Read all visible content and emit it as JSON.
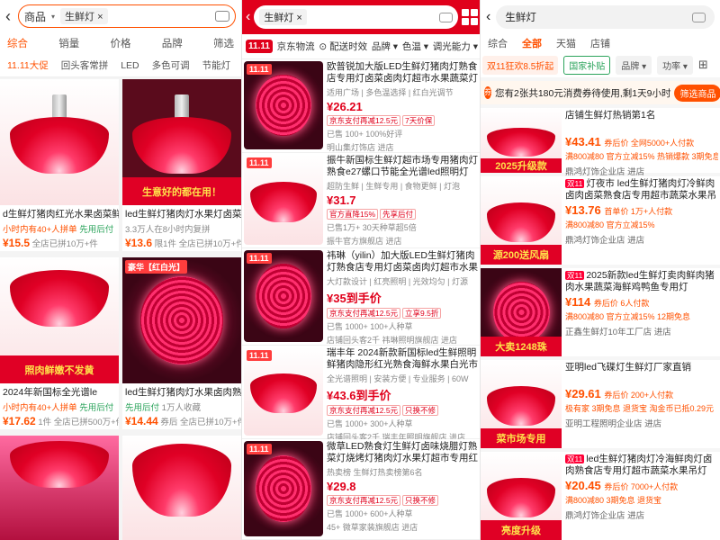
{
  "panel1": {
    "search_scope": "商品",
    "search_chip": "生鲜灯",
    "sort": [
      "综合",
      "销量",
      "价格",
      "品牌",
      "筛选"
    ],
    "tags": [
      "11.11大促",
      "回头客常拼",
      "LED",
      "多色可调",
      "节能灯",
      "圆形"
    ],
    "cards": [
      {
        "title": "d生鲜灯猪肉红光水果卤菜鲜",
        "sub": "小时内有40+人拼单",
        "sub2": "先用后付",
        "price": "¥15.5",
        "meta": "全店已拼10万+件",
        "banner": ""
      },
      {
        "title": "led生鲜灯猪肉灯水果灯卤菜熟",
        "sub": "3.3万人在8小时内复拼",
        "sub2": "",
        "price": "¥13.6",
        "meta": "限1件 全店已拼10万+件",
        "banner": "生意好的都在用！"
      },
      {
        "title": "2024年新国标全光谱le",
        "sub": "小时内有40+人拼单",
        "sub2": "先用后付",
        "price": "¥17.62",
        "meta": "1件 全店已拼500万+件",
        "banner": "照肉鲜嫩不发黄"
      },
      {
        "title": "led生鲜灯猪肉灯水果卤肉熟",
        "sub": "先用后付",
        "sub2": "1万人收藏",
        "price": "¥14.44",
        "meta": "券后 全店已拼10万+件",
        "banner": "豪华【红白光】"
      }
    ]
  },
  "panel2": {
    "search_chip": "生鲜灯",
    "filters": [
      "11.11",
      "京东物流",
      "配送时效",
      "品牌",
      "色温",
      "调光能力"
    ],
    "items": [
      {
        "title": "欧普锐加大版LED生鲜灯猪肉灯熟食店专用灯卤菜卤肉灯超市水果蔬菜灯 鲜肉专",
        "line": "适用广场 | 多色温选择 | 红白光调节",
        "price": "¥26.21",
        "tags": [
          "京东支付再减12.5元",
          "7天价保"
        ],
        "meta": "已售 100+ 100%好评",
        "shop": "明山集灯饰店 进店"
      },
      {
        "title": "振牛新国标生鲜灯超市场专用猪肉灯熟食e27螺口节能全光谱led照明灯 新国标",
        "line": "超防生鲜 | 生鲜专用 | 食物更鲜 | 灯泡",
        "price": "¥31.7",
        "tags": [
          "官方直降15%",
          "先享后付"
        ],
        "meta": "已售1万+ 30天种草超5倍",
        "shop": "振牛官方旗舰店 进店"
      },
      {
        "title": "祎琳（yilin）加大版LED生鲜灯猪肉灯熟食店专用灯卤菜卤肉灯超市水果蔬菜吊灯 鲜",
        "line": "大灯款设计 | 红亮照明 | 光效均匀 | 灯源",
        "price": "¥35到手价",
        "tags": [
          "京东支付再减12.5元",
          "立享9.5折"
        ],
        "meta": "已售 1000+ 100+人种草",
        "shop": "店铺回头客2千 祎琳照明旗舰店 进店"
      },
      {
        "title": "瑞丰年 2024新款新国标led生鲜照明鲜猪肉隐形红光熟食海鲜水果白光市场灯【鲜肉专",
        "line": "全光谱照明 | 安装方便 | 专业服务 | 60W",
        "price": "¥43.6到手价",
        "tags": [
          "京东支付再减12.5元",
          "只换不修"
        ],
        "meta": "已售 1000+ 300+人种草",
        "shop": "店铺回头客2千 瑞丰年照明旗舰店 进店"
      },
      {
        "title": "微草LED熟食灯生鲜灯卤味烧腊灯熟菜灯烧烤灯猪肉灯水果灯超市专用红黄光 45五",
        "line": "热卖榜 生鲜灯热卖榜第6名",
        "price": "¥29.8",
        "tags": [
          "京东支付再减12.5元",
          "只换不修"
        ],
        "meta": "已售 1000+ 600+人种草",
        "shop": "45+ 微草家装旗舰店 进店"
      }
    ]
  },
  "panel3": {
    "search_text": "生鲜灯",
    "tabs": [
      "全部",
      "天猫",
      "店铺"
    ],
    "scope_tab": "综合",
    "chips": [
      "双11狂欢8.5折起",
      "国家补贴",
      "品牌",
      "功率"
    ],
    "coupon": {
      "text": "您有2张共180元消费券待使用,剩1天9小时",
      "btn": "筛选商品"
    },
    "items": [
      {
        "badge": "",
        "title": "店铺生鲜灯热销第1名",
        "price": "¥43.41",
        "price_note": "券后价 全网5000+人付款",
        "meta": "满800减80 官方立减15% 热销爆款 3期免息",
        "shop": "鼎鸿灯饰企业店 进店",
        "banner": "2025升级款"
      },
      {
        "badge": "双11",
        "title": "灯夜市 led生鲜灯猪肉灯冷鲜肉卤肉卤菜熟食店专用超市蔬菜水果吊",
        "price": "¥13.76",
        "price_note": "首单价 1万+人付款",
        "meta": "满800减80 官方立减15%",
        "shop": "鼎鸿灯饰企业店 进店",
        "banner": "源200送风扇"
      },
      {
        "badge": "双11",
        "title": "2025新款led生鲜灯卖肉鲜肉猪肉水果蔬菜海鲜鸡鸭鱼专用灯",
        "price": "¥114",
        "price_note": "券后价 6人付款",
        "meta": "满800减80 官方立减15% 12期免息",
        "shop": "正鑫生鲜灯10年工厂店 进店",
        "banner": "大卖1248珠"
      },
      {
        "badge": "",
        "title": "亚明led飞碟灯生鲜灯厂家直销",
        "price": "¥29.61",
        "price_note": "券后价 200+人付款",
        "meta": "极有家 3期免息 退货宝 淘金币已抵0.29元",
        "shop": "亚明工程照明企业店 进店",
        "banner": "菜市场专用"
      },
      {
        "badge": "双11",
        "title": "led生鲜灯猪肉灯冷海鲜肉灯卤肉熟食店专用灯超市蔬菜水果吊灯",
        "price": "¥20.45",
        "price_note": "券后价 7000+人付款",
        "meta": "满800减80 3期免息 退货宝",
        "shop": "鼎鸿灯饰企业店 进店",
        "banner": "亮度升级"
      }
    ]
  }
}
